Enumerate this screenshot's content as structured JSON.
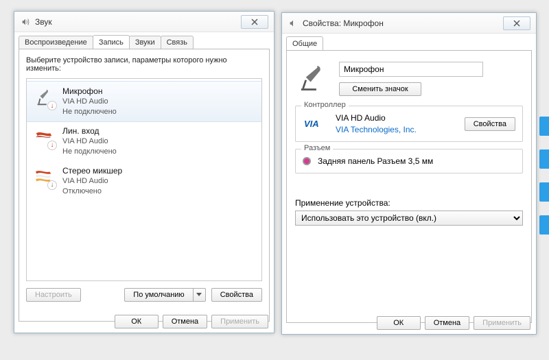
{
  "bg": {
    "stripes": 4
  },
  "window1": {
    "title": "Звук",
    "tabs": [
      "Воспроизведение",
      "Запись",
      "Звуки",
      "Связь"
    ],
    "activeTab": 1,
    "instruction": "Выберите устройство записи, параметры которого нужно изменить:",
    "devices": [
      {
        "name": "Микрофон",
        "driver": "VIA HD Audio",
        "status": "Не подключено",
        "badge": "red",
        "selected": true
      },
      {
        "name": "Лин. вход",
        "driver": "VIA HD Audio",
        "status": "Не подключено",
        "badge": "red",
        "selected": false
      },
      {
        "name": "Стерео микшер",
        "driver": "VIA HD Audio",
        "status": "Отключено",
        "badge": "down",
        "selected": false
      }
    ],
    "buttons": {
      "configure": "Настроить",
      "default": "По умолчанию",
      "properties": "Свойства",
      "ok": "ОК",
      "cancel": "Отмена",
      "apply": "Применить"
    }
  },
  "window2": {
    "title": "Свойства: Микрофон",
    "tabs": [
      "Общие"
    ],
    "activeTab": 0,
    "device_name": "Микрофон",
    "change_icon": "Сменить значок",
    "controller": {
      "group": "Контроллер",
      "name": "VIA HD Audio",
      "vendor": "VIA Technologies, Inc.",
      "properties": "Свойства"
    },
    "jack": {
      "group": "Разъем",
      "text": "Задняя панель Разъем 3,5 мм"
    },
    "usage_label": "Применение устройства:",
    "usage_value": "Использовать это устройство (вкл.)",
    "buttons": {
      "ok": "ОК",
      "cancel": "Отмена",
      "apply": "Применить"
    }
  }
}
